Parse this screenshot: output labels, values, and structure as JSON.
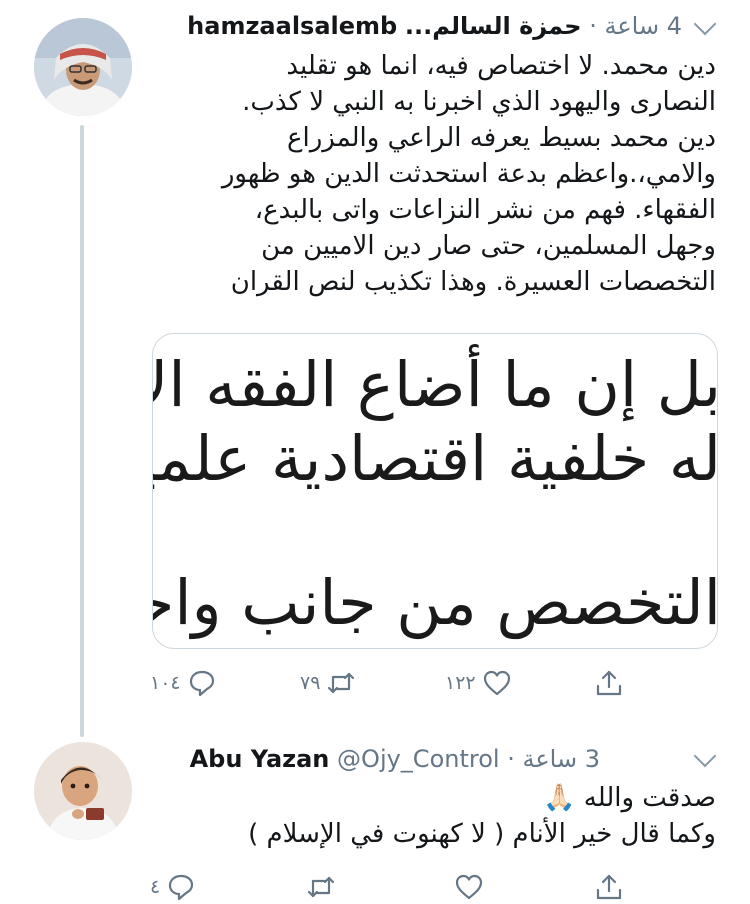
{
  "tweets": [
    {
      "name": "حمزة السالم...",
      "handle": "hamzaalsalemb",
      "time": "4 ساعة",
      "lines": [
        "دين محمد. لا اختصاص فيه، انما هو تقليد",
        "النصارى واليهود الذي اخبرنا به النبي لا كذب.",
        "دين محمد بسيط يعرفه الراعي والمزراع",
        "والامي،.واعظم بدعة استحدثت الدين هو ظهور",
        "الفقهاء. فهم من نشر النزاعات واتى بالبدع،",
        "وجهل المسلمين، حتى صار دين الاميين من",
        "التخصصات العسيرة. وهذا تكذيب لنص القران"
      ],
      "media_lines": [
        "بل إن ما أضاع الفقه الإسلا",
        "له خلفية اقتصادية علمية",
        "التخصص من جانب واحد"
      ],
      "reply_count": "١٠٤",
      "retweet_count": "٧٩",
      "like_count": "١٢٢"
    },
    {
      "name": "Abu Yazan",
      "handle": "@Ojy_Control",
      "time": "3 ساعة",
      "lines": [
        "صدقت والله 🙏🏻",
        "وكما قال خير الأنام ( لا كهنوت في الإسلام )"
      ],
      "reply_count": "٤",
      "retweet_count": "",
      "like_count": ""
    }
  ],
  "icons": {
    "reply": "reply-icon",
    "retweet": "retweet-icon",
    "like": "heart-icon",
    "share": "share-icon",
    "menu": "chevron-down-icon"
  },
  "colors": {
    "text": "#14171a",
    "secondary": "#657786",
    "thread_line": "#ccd6dd",
    "border": "#ccd6dd"
  }
}
